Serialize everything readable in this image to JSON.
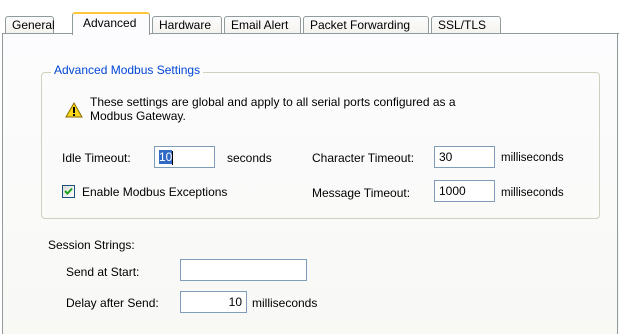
{
  "tabs": [
    {
      "label": "General",
      "active": false
    },
    {
      "label": "Advanced",
      "active": true
    },
    {
      "label": "Hardware",
      "active": false
    },
    {
      "label": "Email Alert",
      "active": false
    },
    {
      "label": "Packet Forwarding",
      "active": false
    },
    {
      "label": "SSL/TLS",
      "active": false
    }
  ],
  "modbus": {
    "group_title": "Advanced Modbus Settings",
    "warning_icon": "warning-triangle-icon",
    "warning_line1": "These settings are global and apply to all serial ports configured as a",
    "warning_line2": "Modbus Gateway.",
    "idle_timeout_label": "Idle Timeout:",
    "idle_timeout_value": "10",
    "idle_timeout_unit": "seconds",
    "character_timeout_label": "Character Timeout:",
    "character_timeout_value": "30",
    "character_timeout_unit": "milliseconds",
    "enable_exceptions_label": "Enable Modbus Exceptions",
    "enable_exceptions_checked": true,
    "message_timeout_label": "Message Timeout:",
    "message_timeout_value": "1000",
    "message_timeout_unit": "milliseconds"
  },
  "session": {
    "title": "Session Strings:",
    "send_at_start_label": "Send at Start:",
    "send_at_start_value": "",
    "delay_label": "Delay after Send:",
    "delay_value": "10",
    "delay_unit": "milliseconds"
  },
  "colors": {
    "tab_border": "#919b9c",
    "active_tab_accent": "#ffc83c",
    "group_title": "#0046d5",
    "textbox_border": "#7f9db9",
    "selection": "#316ac5"
  }
}
